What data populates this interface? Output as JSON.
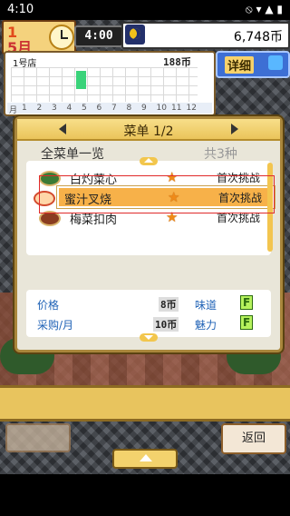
{
  "status_bar": {
    "time": "4:10",
    "icons": "⦸ ▾ ▲ ▮"
  },
  "hud": {
    "day_number": "1",
    "month": "5月",
    "clock_time": "4:00",
    "money": "6,748币"
  },
  "store_panel": {
    "name": "1号店",
    "coins": "188币",
    "month_label": "月",
    "month_ticks": [
      "1",
      "2",
      "3",
      "4",
      "5",
      "6",
      "7",
      "8",
      "9",
      "10",
      "11",
      "12"
    ],
    "current_month_fraction": 0.6
  },
  "detail_button": {
    "label": "详细"
  },
  "menu_dialog": {
    "title": "菜单 1/2",
    "list_title": "全菜单一览",
    "count_label": "共3种",
    "items": [
      {
        "name": "白灼菜心",
        "status": "首次挑战",
        "icon_color": "#3b7a36"
      },
      {
        "name": "蜜汁叉烧",
        "status": "首次挑战",
        "icon_color": "#d24a2b",
        "selected": true
      },
      {
        "name": "梅菜扣肉",
        "status": "首次挑战",
        "icon_color": "#8a3d20"
      }
    ],
    "details": {
      "price_label": "价格",
      "price_value": "8币",
      "taste_label": "味道",
      "taste_grade": "F",
      "cost_label": "采购/月",
      "cost_value": "10币",
      "charm_label": "魅力",
      "charm_grade": "F"
    }
  },
  "back_button": {
    "label": "返回"
  },
  "colors": {
    "accent": "#f7b149",
    "selection_frame": "#e02a2a",
    "gold": "#eac45a"
  }
}
